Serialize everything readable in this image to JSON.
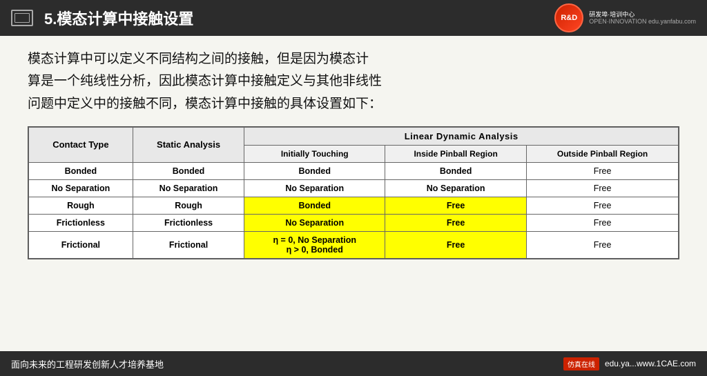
{
  "header": {
    "title": "5.模态计算中接触设置",
    "icon_label": "monitor-icon",
    "logo_symbol": "R&D",
    "logo_subtitle": "研发埠·培训中心",
    "logo_url": "OPEN·INNOVATION  edu.yanfabu.com"
  },
  "intro": {
    "line1": "模态计算中可以定义不同结构之间的接触，但是因为模态计",
    "line2": "算是一个纯线性分析，因此模态计算中接触定义与其他非线性",
    "line3": "问题中定义中的接触不同，模态计算中接触的具体设置如下："
  },
  "table": {
    "col1_header": "Contact Type",
    "col2_header": "Static Analysis",
    "lda_header": "Linear Dynamic Analysis",
    "sub_col1": "Initially Touching",
    "sub_col2": "Inside Pinball Region",
    "sub_col3": "Outside Pinball Region",
    "rows": [
      {
        "type": "Bonded",
        "static": "Bonded",
        "init": "Bonded",
        "init_yellow": false,
        "inside": "Bonded",
        "inside_yellow": false,
        "outside": "Free"
      },
      {
        "type": "No Separation",
        "static": "No Separation",
        "init": "No Separation",
        "init_yellow": false,
        "inside": "No Separation",
        "inside_yellow": false,
        "outside": "Free"
      },
      {
        "type": "Rough",
        "static": "Rough",
        "init": "Bonded",
        "init_yellow": true,
        "inside": "Free",
        "inside_yellow": true,
        "outside": "Free"
      },
      {
        "type": "Frictionless",
        "static": "Frictionless",
        "init": "No Separation",
        "init_yellow": true,
        "inside": "Free",
        "inside_yellow": true,
        "outside": "Free"
      },
      {
        "type": "Frictional",
        "static": "Frictional",
        "init": "η = 0, No Separation\nη > 0, Bonded",
        "init_yellow": true,
        "inside": "Free",
        "inside_yellow": true,
        "outside": "Free"
      }
    ]
  },
  "footer": {
    "left_text": "面向未来的工程研发创新人才培养基地",
    "badge": "仿真在线",
    "right_text": "edu.ya...www.1CAE.com"
  }
}
